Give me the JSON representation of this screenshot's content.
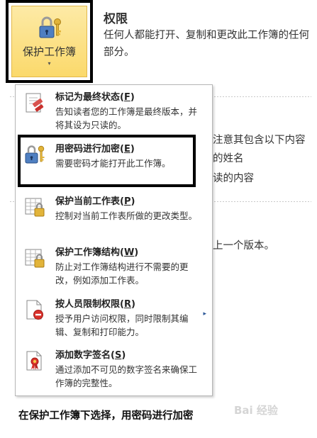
{
  "protect_tile": {
    "label": "保护工作簿",
    "caret": "▾"
  },
  "background": {
    "title": "权限",
    "description": "任何人都能打开、复制和更改此工作簿的任何部分。",
    "fragments": [
      "注意其包含以下内容",
      "的姓名",
      "读的内容",
      "上一个版本。"
    ]
  },
  "menu": {
    "items": [
      {
        "title": "标记为最终状态(",
        "key": "F",
        "suffix": ")",
        "desc": "告知读者您的工作簿是最终版本，并将其设为只读的。",
        "icon": "final-stamp-icon"
      },
      {
        "title": "用密码进行加密(",
        "key": "E",
        "suffix": ")",
        "desc": "需要密码才能打开此工作簿。",
        "icon": "lock-key-icon"
      },
      {
        "title": "保护当前工作表(",
        "key": "P",
        "suffix": ")",
        "desc": "控制对当前工作表所做的更改类型。",
        "icon": "sheet-lock-icon"
      },
      {
        "title": "保护工作簿结构(",
        "key": "W",
        "suffix": ")",
        "desc": "防止对工作簿结构进行不需要的更改，例如添加工作表。",
        "icon": "workbook-structure-lock-icon"
      },
      {
        "title": "按人员限制权限(",
        "key": "R",
        "suffix": ")",
        "desc": "授予用户访问权限，同时限制其编辑、复制和打印能力。",
        "icon": "restrict-permission-icon"
      },
      {
        "title": "添加数字签名(",
        "key": "S",
        "suffix": ")",
        "desc": "通过添加不可见的数字签名来确保工作簿的完整性。",
        "icon": "digital-signature-icon"
      }
    ],
    "submenu_arrow": "▸"
  },
  "caption": "在保护工作簿下选择，用密码进行加密",
  "watermark": "Bai 经验",
  "colors": {
    "tile_gold": "#fbd96b",
    "frame_black": "#000000",
    "accent_blue": "#2b5797"
  }
}
